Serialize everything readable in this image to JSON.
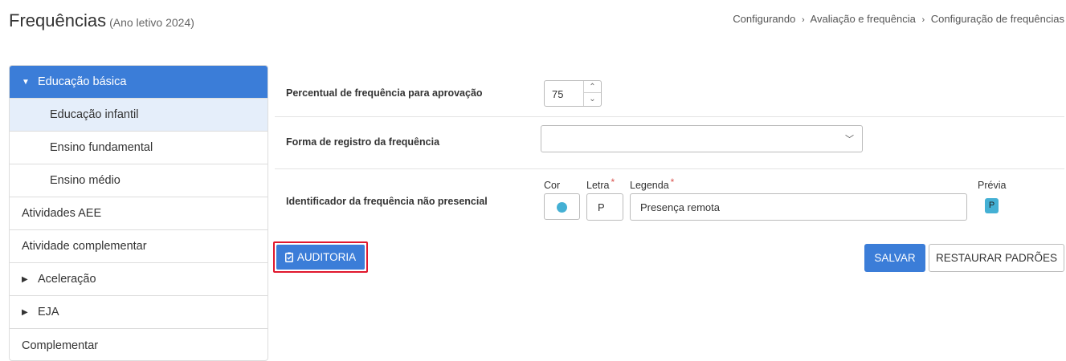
{
  "header": {
    "title": "Frequências",
    "subtitle": "(Ano letivo 2024)"
  },
  "breadcrumb": {
    "items": [
      "Configurando",
      "Avaliação e frequência",
      "Configuração de frequências"
    ],
    "separator": "›"
  },
  "sidebar": {
    "items": [
      {
        "label": "Educação básica",
        "state": "active",
        "caret": "down"
      },
      {
        "label": "Educação infantil",
        "state": "selected-child"
      },
      {
        "label": "Ensino fundamental",
        "state": "child"
      },
      {
        "label": "Ensino médio",
        "state": "child"
      },
      {
        "label": "Atividades AEE",
        "state": "normal"
      },
      {
        "label": "Atividade complementar",
        "state": "normal"
      },
      {
        "label": "Aceleração",
        "state": "normal",
        "caret": "right"
      },
      {
        "label": "EJA",
        "state": "normal",
        "caret": "right"
      },
      {
        "label": "Complementar",
        "state": "normal"
      }
    ]
  },
  "form": {
    "percentual_label": "Percentual de frequência para aprovação",
    "percentual_value": "75",
    "forma_label": "Forma de registro da frequência",
    "forma_value": "",
    "identificador_label": "Identificador da frequência não presencial",
    "cor_label": "Cor",
    "cor_value": "#44b0d4",
    "letra_label": "Letra",
    "letra_value": "P",
    "legenda_label": "Legenda",
    "legenda_value": "Presença remota",
    "required_mark": "*",
    "previa_label": "Prévia",
    "previa_value": "P"
  },
  "actions": {
    "auditoria": "AUDITORIA",
    "salvar": "SALVAR",
    "restaurar": "RESTAURAR PADRÕES"
  },
  "colors": {
    "primary": "#3b7dd8",
    "highlight_border": "#e0182d",
    "selected_bg": "#e5eefa"
  }
}
